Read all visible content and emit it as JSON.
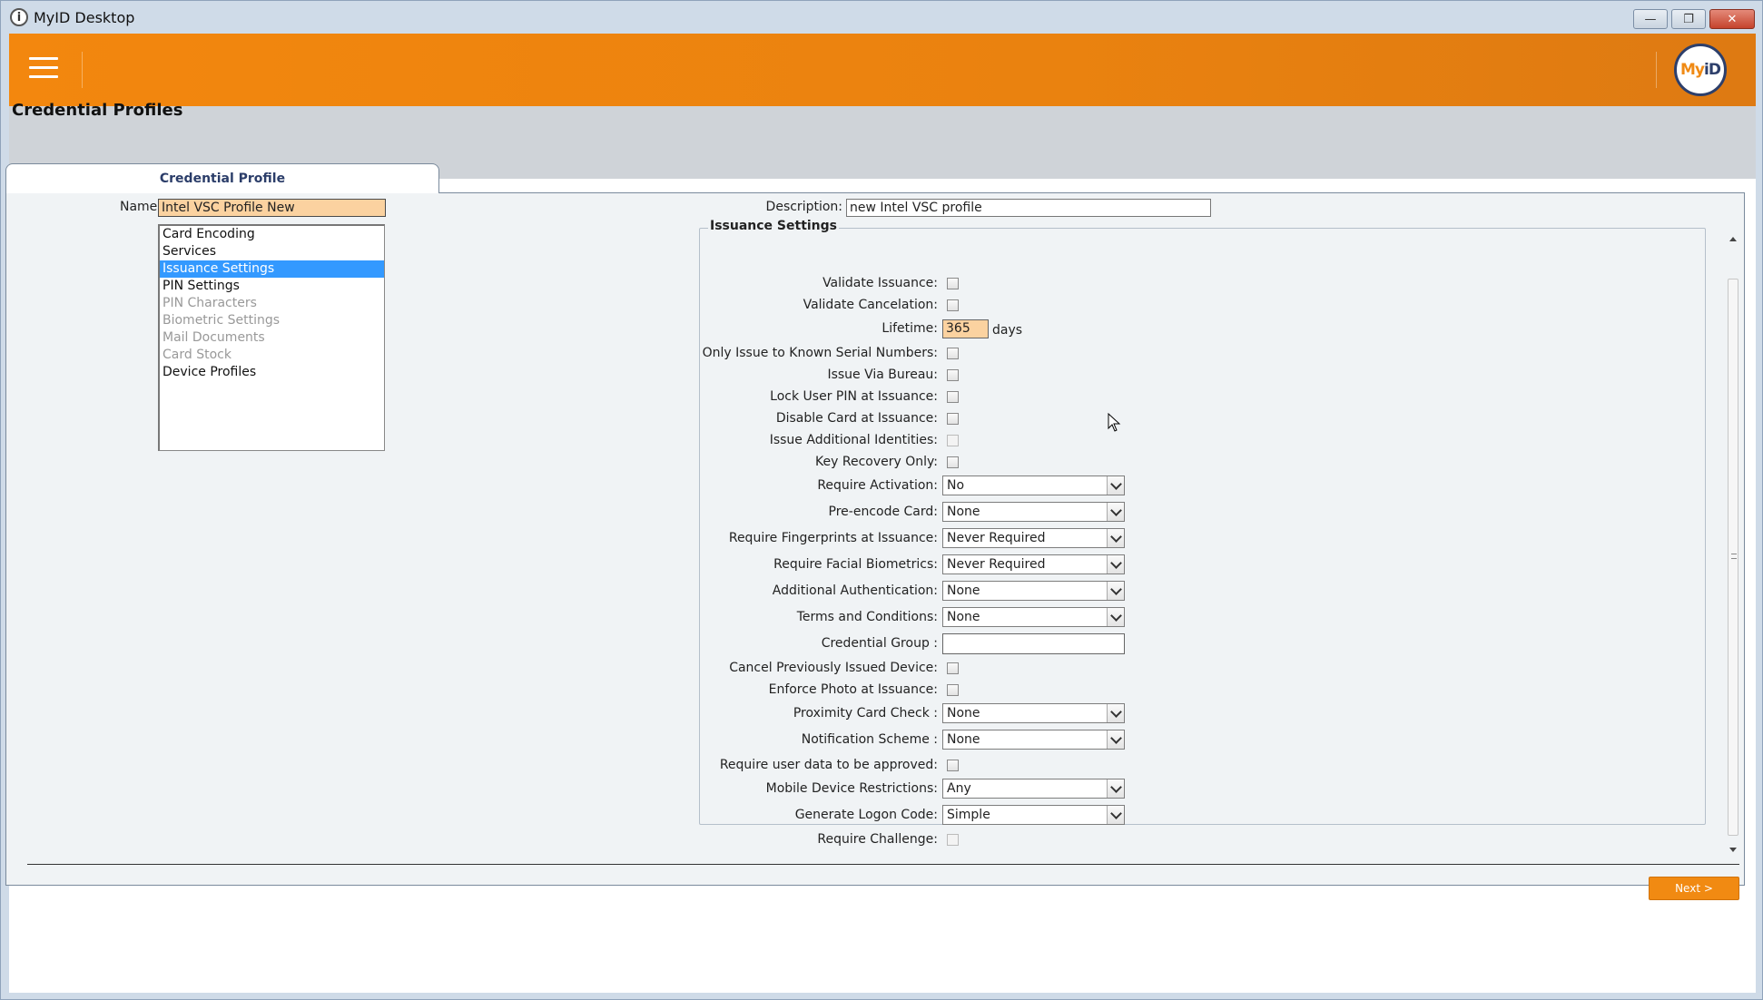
{
  "window": {
    "title": "MyID Desktop",
    "minimize_glyph": "—",
    "maximize_glyph": "❐",
    "close_glyph": "✕"
  },
  "header": {
    "logo_text_a": "My",
    "logo_text_b": "iD"
  },
  "page": {
    "title": "Credential Profiles"
  },
  "tab": {
    "label": "Credential Profile"
  },
  "form": {
    "name_label": "Name:",
    "name_value": "Intel VSC Profile New",
    "description_label": "Description:",
    "description_value": "new Intel VSC profile"
  },
  "sections": [
    {
      "label": "Card Encoding",
      "state": "normal"
    },
    {
      "label": "Services",
      "state": "normal"
    },
    {
      "label": "Issuance Settings",
      "state": "selected"
    },
    {
      "label": "PIN Settings",
      "state": "normal"
    },
    {
      "label": "PIN Characters",
      "state": "disabled"
    },
    {
      "label": "Biometric Settings",
      "state": "disabled"
    },
    {
      "label": "Mail Documents",
      "state": "disabled"
    },
    {
      "label": "Card Stock",
      "state": "disabled"
    },
    {
      "label": "Device Profiles",
      "state": "normal"
    }
  ],
  "issuance": {
    "legend": "Issuance Settings",
    "validate_issuance": "Validate Issuance:",
    "validate_cancelation": "Validate Cancelation:",
    "lifetime": "Lifetime:",
    "lifetime_value": "365",
    "lifetime_unit": "days",
    "known_serials": "Only Issue to Known Serial Numbers:",
    "via_bureau": "Issue Via Bureau:",
    "lock_pin": "Lock User PIN at Issuance:",
    "disable_card": "Disable Card at Issuance:",
    "additional_identities": "Issue Additional Identities:",
    "key_recovery": "Key Recovery Only:",
    "require_activation": "Require Activation:",
    "require_activation_value": "No",
    "pre_encode": "Pre-encode Card:",
    "pre_encode_value": "None",
    "fingerprints": "Require Fingerprints at Issuance:",
    "fingerprints_value": "Never Required",
    "facial": "Require Facial Biometrics:",
    "facial_value": "Never Required",
    "additional_auth": "Additional Authentication:",
    "additional_auth_value": "None",
    "terms": "Terms and Conditions:",
    "terms_value": "None",
    "credential_group": "Credential Group :",
    "cancel_previous": "Cancel Previously Issued Device:",
    "enforce_photo": "Enforce Photo at Issuance:",
    "proximity": "Proximity Card Check :",
    "proximity_value": "None",
    "notification": "Notification Scheme :",
    "notification_value": "None",
    "approve_user_data": "Require user data to be approved:",
    "mobile_restrictions": "Mobile Device Restrictions:",
    "mobile_restrictions_value": "Any",
    "logon_code": "Generate Logon Code:",
    "logon_code_value": "Simple",
    "require_challenge": "Require Challenge:"
  },
  "actions": {
    "next": "Next >"
  }
}
